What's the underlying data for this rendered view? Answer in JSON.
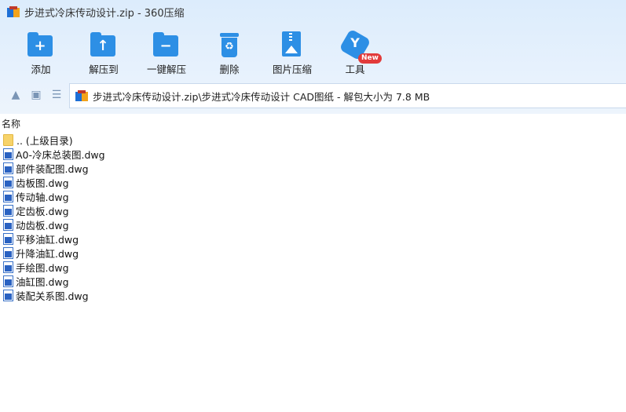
{
  "window": {
    "title": "步进式冷床传动设计.zip - 360压缩"
  },
  "toolbar": {
    "items": [
      {
        "label": "添加",
        "icon": "add-folder-icon"
      },
      {
        "label": "解压到",
        "icon": "extract-to-icon"
      },
      {
        "label": "一键解压",
        "icon": "one-click-extract-icon"
      },
      {
        "label": "删除",
        "icon": "trash-icon"
      },
      {
        "label": "图片压缩",
        "icon": "image-compress-icon"
      },
      {
        "label": "工具",
        "icon": "tools-icon",
        "badge": "New"
      }
    ]
  },
  "address": {
    "path": "步进式冷床传动设计.zip\\步进式冷床传动设计 CAD图纸 - 解包大小为 7.8 MB"
  },
  "list": {
    "column_name": "名称",
    "files": [
      {
        "name": ".. (上级目录)",
        "type": "folder"
      },
      {
        "name": "A0-冷床总装图.dwg",
        "type": "dwg"
      },
      {
        "name": "部件装配图.dwg",
        "type": "dwg"
      },
      {
        "name": "齿板图.dwg",
        "type": "dwg"
      },
      {
        "name": "传动轴.dwg",
        "type": "dwg"
      },
      {
        "name": "定齿板.dwg",
        "type": "dwg"
      },
      {
        "name": "动齿板.dwg",
        "type": "dwg"
      },
      {
        "name": "平移油缸.dwg",
        "type": "dwg"
      },
      {
        "name": "升降油缸.dwg",
        "type": "dwg"
      },
      {
        "name": "手绘图.dwg",
        "type": "dwg"
      },
      {
        "name": "油缸图.dwg",
        "type": "dwg"
      },
      {
        "name": "装配关系图.dwg",
        "type": "dwg"
      }
    ]
  },
  "colors": {
    "accent": "#2d8fe5",
    "header_bg": "#dcecfc",
    "badge": "#e23b3b"
  }
}
